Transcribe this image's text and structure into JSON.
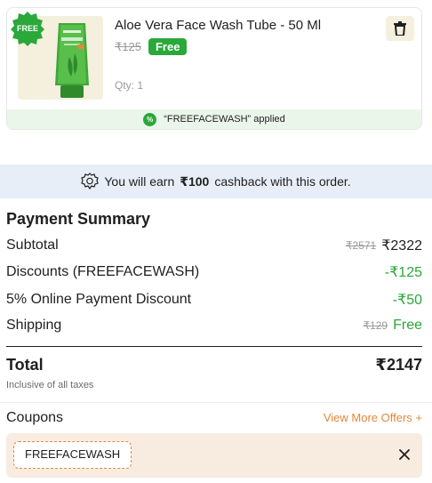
{
  "product": {
    "badge": "FREE",
    "name": "Aloe Vera Face Wash Tube - 50 Ml",
    "original_price": "₹125",
    "price_tag": "Free",
    "quantity": "Qty: 1",
    "coupon_applied": "“FREEFACEWASH” applied",
    "percent_symbol": "%"
  },
  "cashback": {
    "prefix": "You will earn",
    "amount": "₹100",
    "suffix": "cashback with this order."
  },
  "summary": {
    "title": "Payment Summary",
    "rows": [
      {
        "label": "Subtotal",
        "strike": "₹2571",
        "value": "₹2322"
      },
      {
        "label": "Discounts (FREEFACEWASH)",
        "value": "-₹125"
      },
      {
        "label": "5% Online Payment Discount",
        "value": "-₹50"
      },
      {
        "label": "Shipping",
        "strike": "₹129",
        "value": "Free"
      }
    ],
    "total_label": "Total",
    "total_value": "₹2147",
    "tax_note": "Inclusive of all taxes"
  },
  "coupons": {
    "title": "Coupons",
    "more_offers": "View More Offers +",
    "code": "FREEFACEWASH"
  },
  "colors": {
    "accent_green": "#2aa83a",
    "accent_orange": "#e0883a",
    "banner_blue": "#e7eef8",
    "coupon_bg": "#f8ebe0"
  }
}
